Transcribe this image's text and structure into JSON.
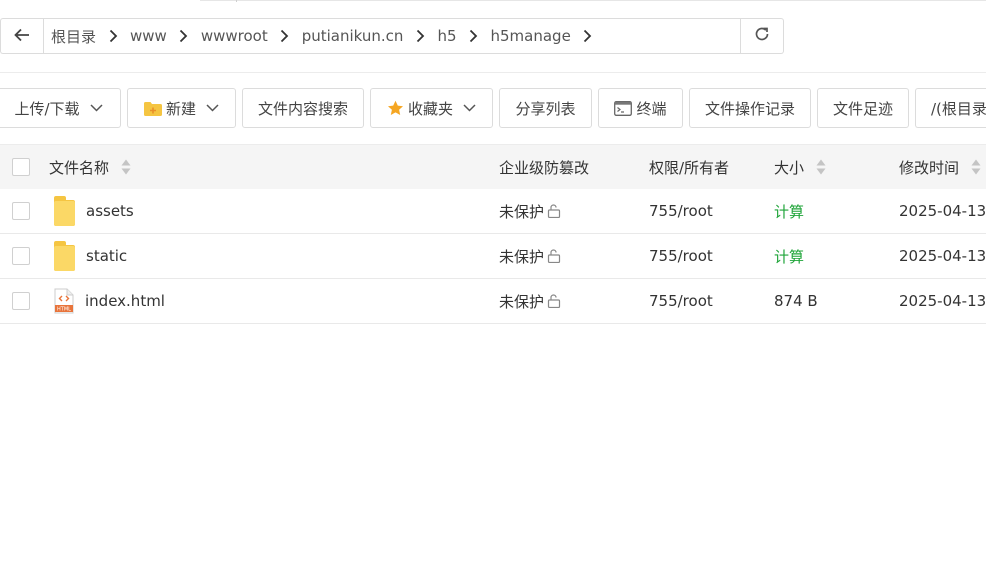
{
  "path": {
    "crumbs": [
      "根目录",
      "www",
      "wwwroot",
      "putianikun.cn",
      "h5",
      "h5manage"
    ]
  },
  "toolbar": {
    "upload_label": "上传/下载",
    "new_label": "新建",
    "search_label": "文件内容搜索",
    "favorites_label": "收藏夹",
    "share_label": "分享列表",
    "terminal_label": "终端",
    "oplog_label": "文件操作记录",
    "footprint_label": "文件足迹",
    "root_label": "/(根目录"
  },
  "table": {
    "headers": {
      "name": "文件名称",
      "protect": "企业级防篡改",
      "perm": "权限/所有者",
      "size": "大小",
      "mtime": "修改时间"
    },
    "rows": [
      {
        "name": "assets",
        "type": "folder",
        "protect": "未保护",
        "perm": "755/root",
        "size": "计算",
        "mtime": "2025-04-13"
      },
      {
        "name": "static",
        "type": "folder",
        "protect": "未保护",
        "perm": "755/root",
        "size": "计算",
        "mtime": "2025-04-13"
      },
      {
        "name": "index.html",
        "type": "html-file",
        "protect": "未保护",
        "perm": "755/root",
        "size": "874 B",
        "mtime": "2025-04-13"
      }
    ]
  },
  "colors": {
    "accent_green": "#20a53a",
    "folder_yellow": "#f5c542",
    "star_gold": "#f5a623"
  },
  "icons": [
    "back-arrow-icon",
    "chevron-right-icon",
    "refresh-icon",
    "chevron-down-icon",
    "new-folder-icon",
    "star-icon",
    "terminal-icon",
    "folder-icon",
    "html-file-icon",
    "unlock-icon",
    "sort-icon"
  ]
}
